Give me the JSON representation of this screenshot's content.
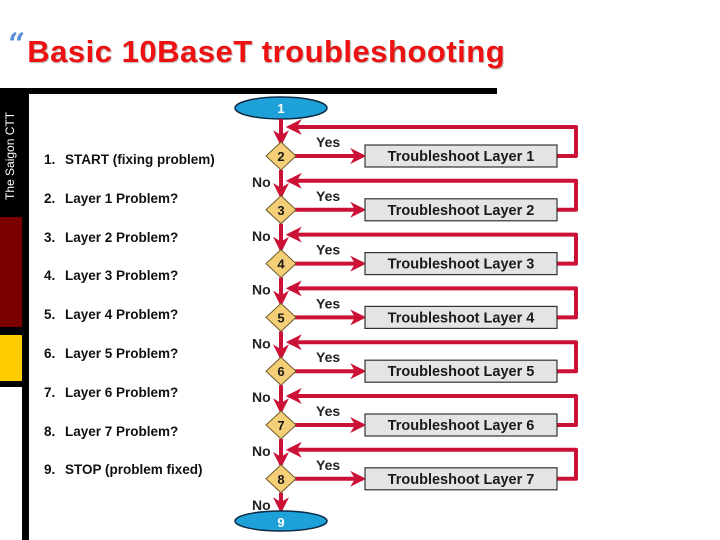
{
  "slide": {
    "bullet_glyph": "“",
    "title": "Basic 10BaseT troubleshooting",
    "side_label": "The Saigon CTT"
  },
  "steps": [
    {
      "num": "1.",
      "text": "START (fixing problem)"
    },
    {
      "num": "2.",
      "text": "Layer 1 Problem?"
    },
    {
      "num": "3.",
      "text": "Layer 2 Problem?"
    },
    {
      "num": "4.",
      "text": "Layer 3 Problem?"
    },
    {
      "num": "5.",
      "text": "Layer 4 Problem?"
    },
    {
      "num": "6.",
      "text": "Layer 5 Problem?"
    },
    {
      "num": "7.",
      "text": "Layer 6 Problem?"
    },
    {
      "num": "8.",
      "text": "Layer 7 Problem?"
    },
    {
      "num": "9.",
      "text": "STOP (problem fixed)"
    }
  ],
  "flowchart": {
    "start_node": "1",
    "end_node": "9",
    "yes_label": "Yes",
    "no_label": "No",
    "decisions": [
      {
        "node": "2",
        "action": "Troubleshoot Layer 1"
      },
      {
        "node": "3",
        "action": "Troubleshoot Layer 2"
      },
      {
        "node": "4",
        "action": "Troubleshoot Layer 3"
      },
      {
        "node": "5",
        "action": "Troubleshoot Layer 4"
      },
      {
        "node": "6",
        "action": "Troubleshoot Layer 5"
      },
      {
        "node": "7",
        "action": "Troubleshoot Layer 6"
      },
      {
        "node": "8",
        "action": "Troubleshoot Layer 7"
      }
    ]
  },
  "colors": {
    "title": "#ee1111",
    "arrow": "#cc1136",
    "terminal": "#1ea0d8",
    "decision": "#f5cf78",
    "action_box": "#e4e4e4",
    "sidebar_red": "#7a0000",
    "sidebar_yellow": "#ffcc00"
  }
}
